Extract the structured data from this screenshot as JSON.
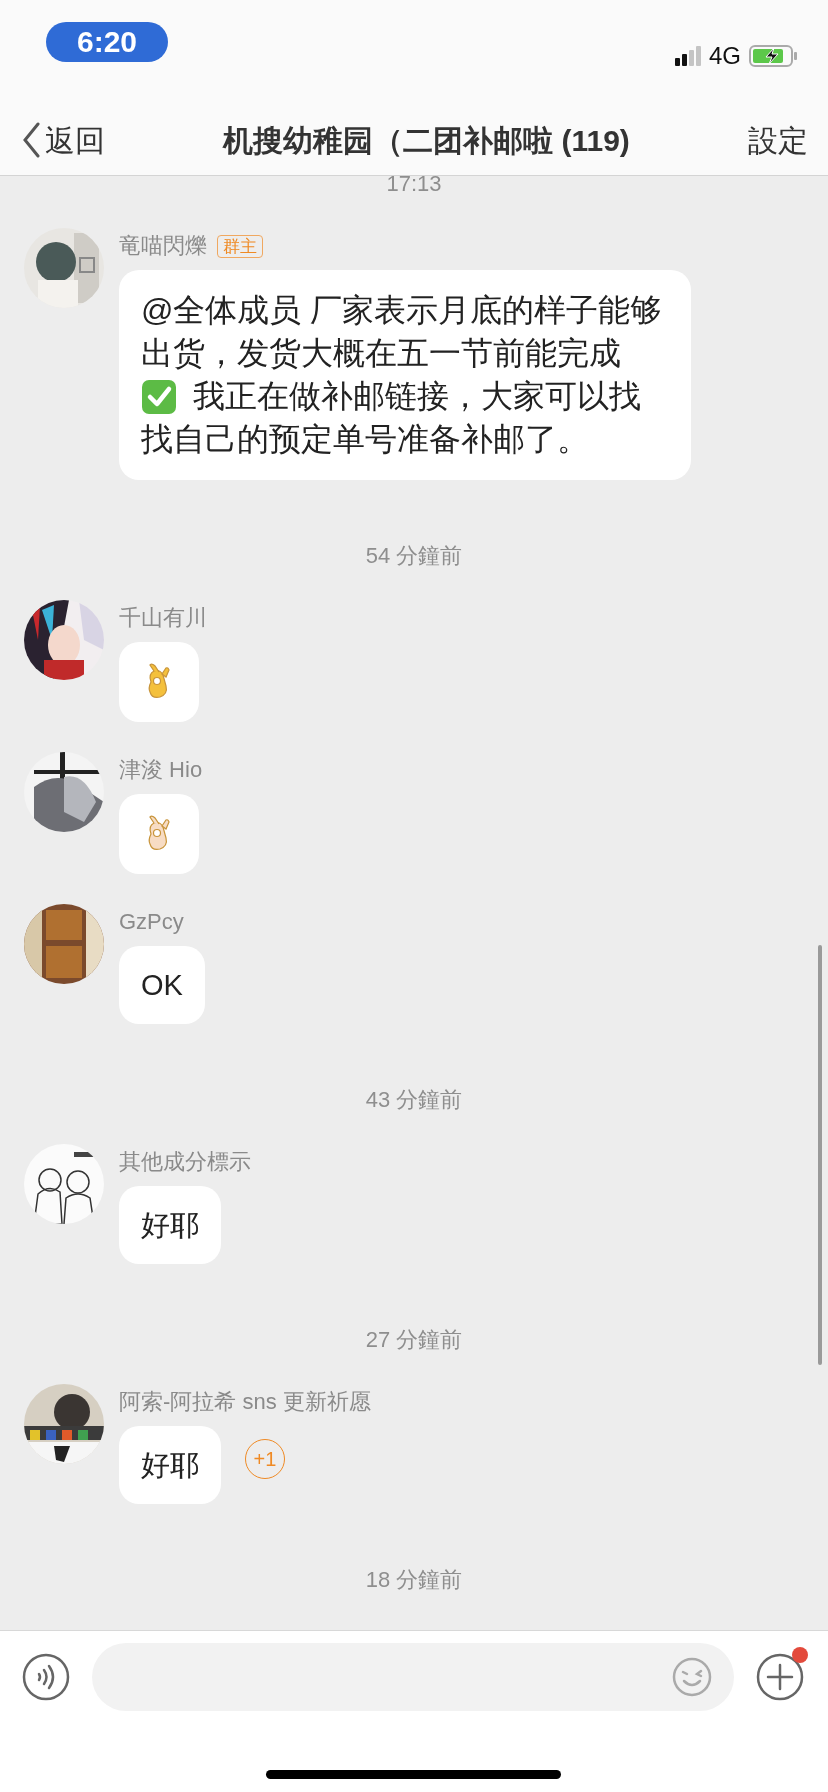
{
  "status_bar": {
    "time": "6:20",
    "network": "4G"
  },
  "nav": {
    "back": "返回",
    "title": "机搜幼稚园（二团补邮啦 (119)",
    "settings": "設定"
  },
  "feed": [
    {
      "kind": "time",
      "text": "17:13"
    },
    {
      "kind": "message",
      "sender": "竜喵閃爍",
      "role": "群主",
      "parts": [
        {
          "kind": "text",
          "text": "@全体成员 厂家表示月底的样子能够出货，发货大概在五一节前能完成"
        },
        {
          "kind": "check"
        },
        {
          "kind": "text",
          "text": "我正在做补邮链接，大家可以找"
        },
        {
          "kind": "text",
          "text": "找自己的预定单号准备补邮了。"
        }
      ]
    },
    {
      "kind": "time",
      "text": "54 分鐘前"
    },
    {
      "kind": "message",
      "sender": "千山有川",
      "parts": [
        {
          "kind": "ok-hand",
          "color": "#f4c03c"
        }
      ]
    },
    {
      "kind": "message",
      "sender": "津浚 Hio",
      "parts": [
        {
          "kind": "ok-hand",
          "color": "#f7dcc4"
        }
      ]
    },
    {
      "kind": "message",
      "sender": "GzPcy",
      "parts": [
        {
          "kind": "text",
          "text": "OK"
        }
      ]
    },
    {
      "kind": "time",
      "text": "43 分鐘前"
    },
    {
      "kind": "message",
      "sender": "其他成分標示",
      "parts": [
        {
          "kind": "text",
          "text": "好耶"
        }
      ]
    },
    {
      "kind": "time",
      "text": "27 分鐘前"
    },
    {
      "kind": "message",
      "sender": "阿索-阿拉希 sns 更新祈愿",
      "parts": [
        {
          "kind": "text",
          "text": "好耶"
        }
      ],
      "plus_one": "+1"
    },
    {
      "kind": "time",
      "text": "18 分鐘前"
    }
  ],
  "composer": {
    "notification": true
  }
}
